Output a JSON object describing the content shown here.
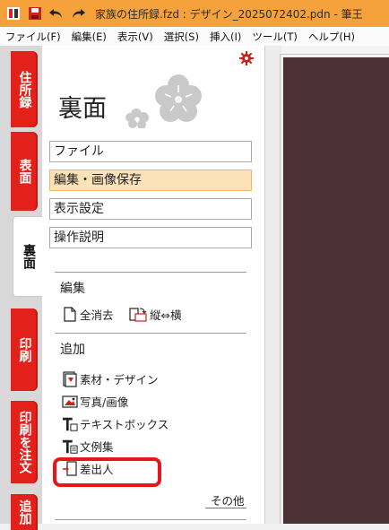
{
  "window": {
    "title": "家族の住所録.fzd : デザイン_2025072402.pdn - 筆王"
  },
  "menubar": {
    "items": [
      "ファイル(F)",
      "編集(E)",
      "表示(V)",
      "選択(S)",
      "挿入(I)",
      "ツール(T)",
      "ヘルプ(H)"
    ]
  },
  "tabs": {
    "address": "住所録",
    "front": "表面",
    "back": "裏面",
    "print": "印刷",
    "order": "印刷を注文",
    "add": "追加"
  },
  "panel": {
    "title": "裏面",
    "menu": [
      "ファイル",
      "編集・画像保存",
      "表示設定",
      "操作説明"
    ],
    "edit_section": "編集",
    "edit_clear": "全消去",
    "edit_rotate": "縦⇔横",
    "add_section": "追加",
    "add_items": [
      "素材・デザイン",
      "写真/画像",
      "テキストボックス",
      "文例集",
      "差出人"
    ],
    "more": "その他"
  },
  "colors": {
    "titlebar": "#f5a23c",
    "tab_red": "#e4201b",
    "selected_menu": "#fde1b7",
    "canvas": "#4b3036",
    "highlight": "#e8161a"
  }
}
